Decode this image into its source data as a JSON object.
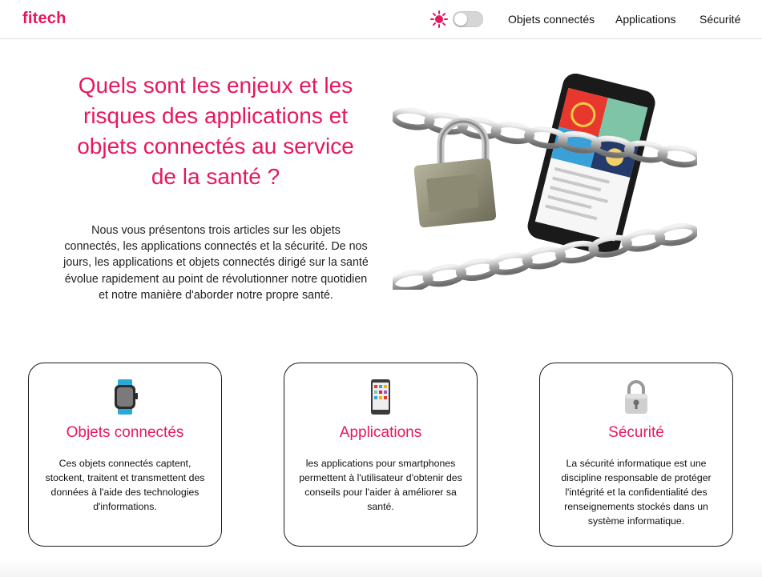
{
  "header": {
    "logo": "fitech",
    "theme_icon": "sun-icon",
    "nav": [
      {
        "label": "Objets connectés"
      },
      {
        "label": "Applications"
      },
      {
        "label": "Sécurité"
      }
    ]
  },
  "hero": {
    "title": "Quels sont les enjeux et les risques des applications et objets connectés au service de la santé ?",
    "text": "Nous vous présentons trois articles sur les objets connectés, les applications connectés et la sécurité. De nos jours, les applications et objets connectés dirigé sur la santé évolue rapidement au point de révolutionner notre quotidien et notre manière d'aborder notre propre santé.",
    "image": "locked-smartphone-illustration"
  },
  "cards": [
    {
      "icon": "smartwatch-icon",
      "title": "Objets connectés",
      "text": "Ces objets connectés captent, stockent, traitent et transmettent des données à l'aide des technologies d'informations."
    },
    {
      "icon": "smartphone-icon",
      "title": "Applications",
      "text": "les applications pour smartphones permettent à l'utilisateur d'obtenir des conseils pour l'aider à améliorer sa santé."
    },
    {
      "icon": "padlock-icon",
      "title": "Sécurité",
      "text": "La sécurité informatique est une discipline responsable de protéger l'intégrité et la confidentialité des renseignements stockés dans un système informatique."
    }
  ],
  "colors": {
    "accent": "#e8175d",
    "border": "#1a1a1a"
  }
}
